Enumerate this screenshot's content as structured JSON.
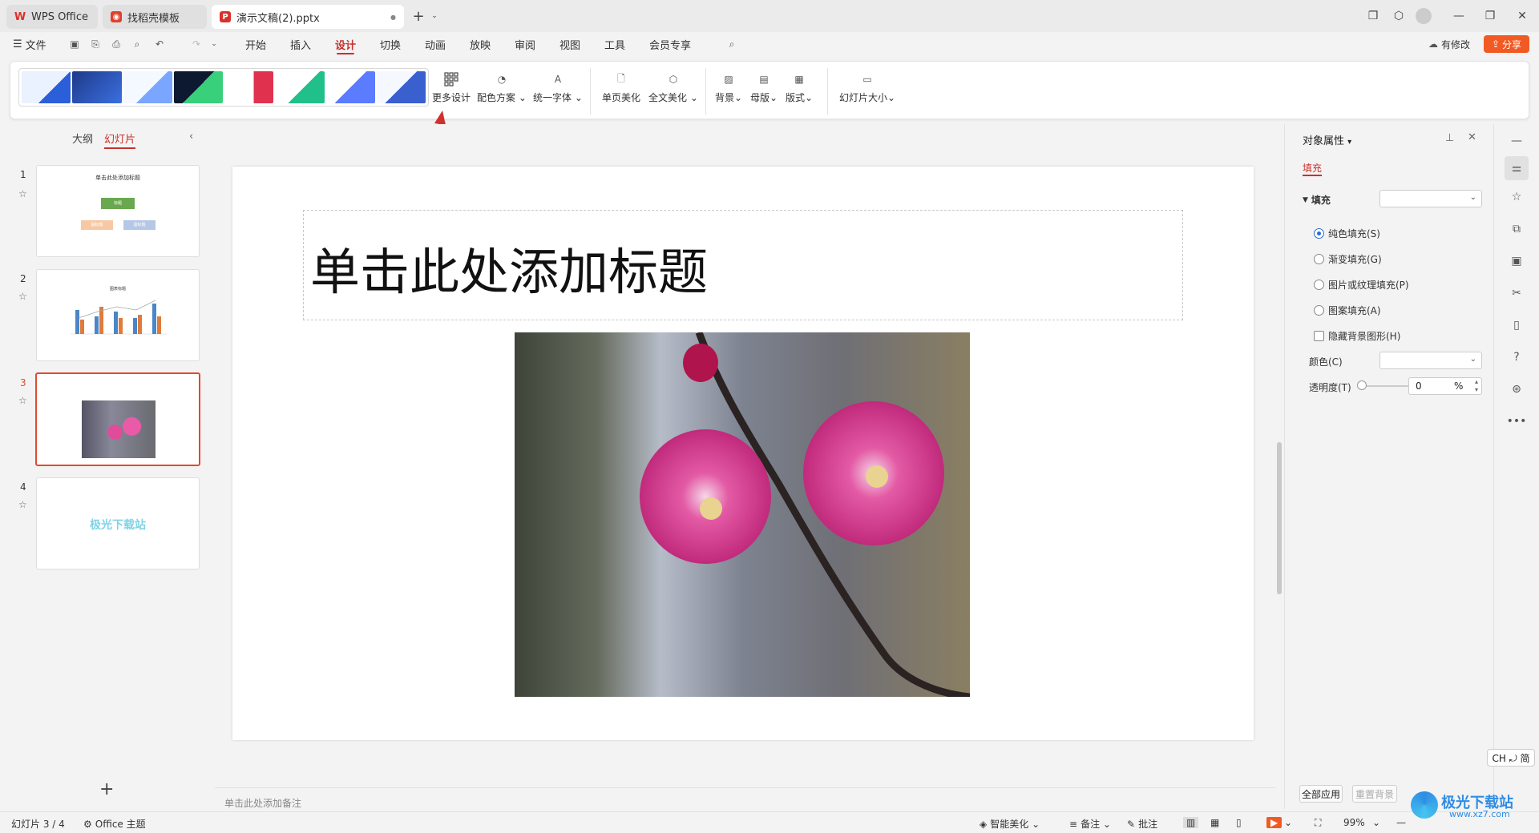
{
  "tabs": [
    {
      "label": "WPS Office"
    },
    {
      "label": "找稻壳模板"
    },
    {
      "label": "演示文稿(2).pptx"
    }
  ],
  "menu": {
    "file": "文件",
    "items": [
      "开始",
      "插入",
      "设计",
      "切换",
      "动画",
      "放映",
      "审阅",
      "视图",
      "工具",
      "会员专享"
    ],
    "active": "设计",
    "modify_label": "有修改",
    "share_label": "分享"
  },
  "ribbon": {
    "more_design": "更多设计",
    "color_scheme": "配色方案",
    "unify_font": "统一字体",
    "single_beautify": "单页美化",
    "full_beautify": "全文美化",
    "background": "背景",
    "master": "母版",
    "layout": "版式",
    "slide_size": "幻灯片大小",
    "colors": {
      "accent": "#c7312c",
      "share": "#f15a22",
      "arrow": "#d0312d"
    }
  },
  "left_panel": {
    "tab_outline": "大纲",
    "tab_slides": "幻灯片",
    "slides": [
      {
        "num": "1",
        "title": "单击此处添加标题",
        "box1": "标题",
        "box2": "副标题",
        "box3": "副标题"
      },
      {
        "num": "2",
        "title": "图表标题"
      },
      {
        "num": "3"
      },
      {
        "num": "4",
        "text": "极光下载站"
      }
    ],
    "selected": 3,
    "add_icon": "+"
  },
  "slide": {
    "title_placeholder": "单击此处添加标题"
  },
  "notes_placeholder": "单击此处添加备注",
  "right_panel": {
    "title": "对象属性",
    "tab_fill": "填充",
    "section_fill": "填充",
    "options": [
      {
        "label": "纯色填充(S)",
        "selected": true
      },
      {
        "label": "渐变填充(G)",
        "selected": false
      },
      {
        "label": "图片或纹理填充(P)",
        "selected": false
      },
      {
        "label": "图案填充(A)",
        "selected": false
      }
    ],
    "hide_bg": "隐藏背景图形(H)",
    "color_label": "颜色(C)",
    "transparency_label": "透明度(T)",
    "transparency_value": "0",
    "percent": "%",
    "apply_all": "全部应用",
    "reset_bg": "重置背景"
  },
  "ime": "CH ⤾ 简",
  "status": {
    "slide_count": "幻灯片 3 / 4",
    "theme": "Office 主题",
    "smart_beautify": "智能美化",
    "notes": "备注",
    "comments": "批注",
    "zoom": "99%"
  },
  "watermark": {
    "text": "极光下载站",
    "url": "www.xz7.com"
  }
}
